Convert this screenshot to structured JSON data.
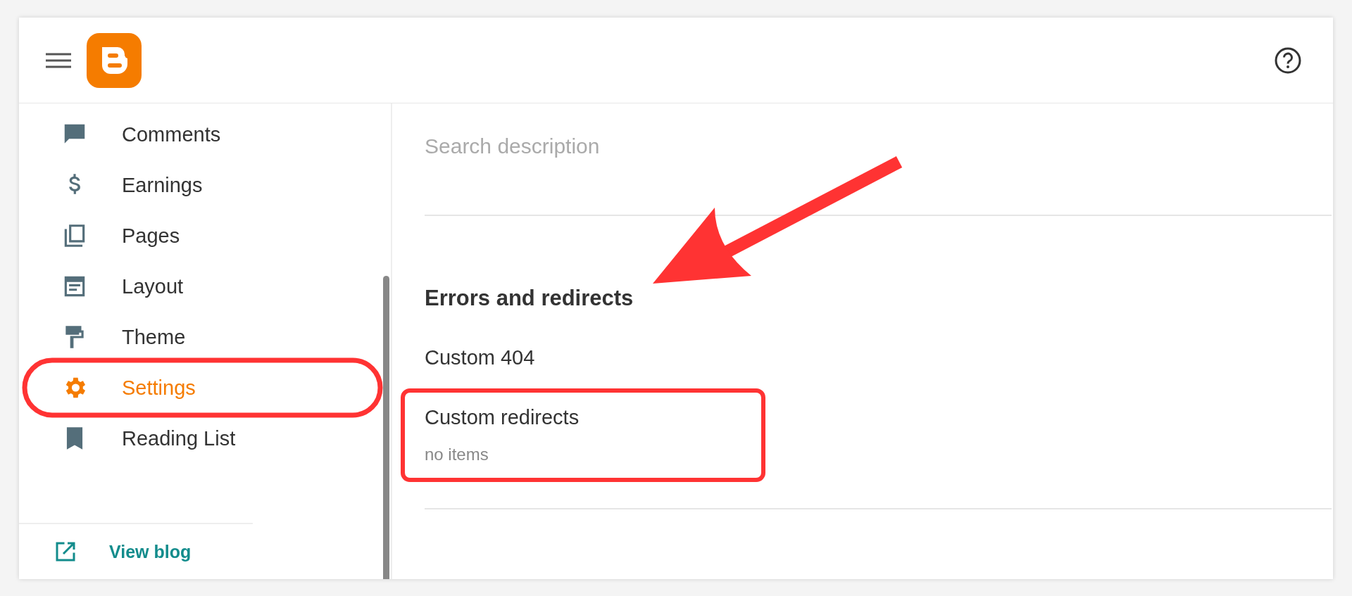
{
  "sidebar": {
    "items": [
      {
        "label": "Comments",
        "selected": false
      },
      {
        "label": "Earnings",
        "selected": false
      },
      {
        "label": "Pages",
        "selected": false
      },
      {
        "label": "Layout",
        "selected": false
      },
      {
        "label": "Theme",
        "selected": false
      },
      {
        "label": "Settings",
        "selected": true
      },
      {
        "label": "Reading List",
        "selected": false
      }
    ],
    "footer_link": {
      "label": "View blog"
    }
  },
  "content": {
    "search_description": {
      "placeholder": "Search description"
    },
    "section": {
      "title": "Errors and redirects",
      "items": [
        {
          "label": "Custom 404"
        },
        {
          "label": "Custom redirects",
          "value": "no items"
        }
      ]
    }
  }
}
